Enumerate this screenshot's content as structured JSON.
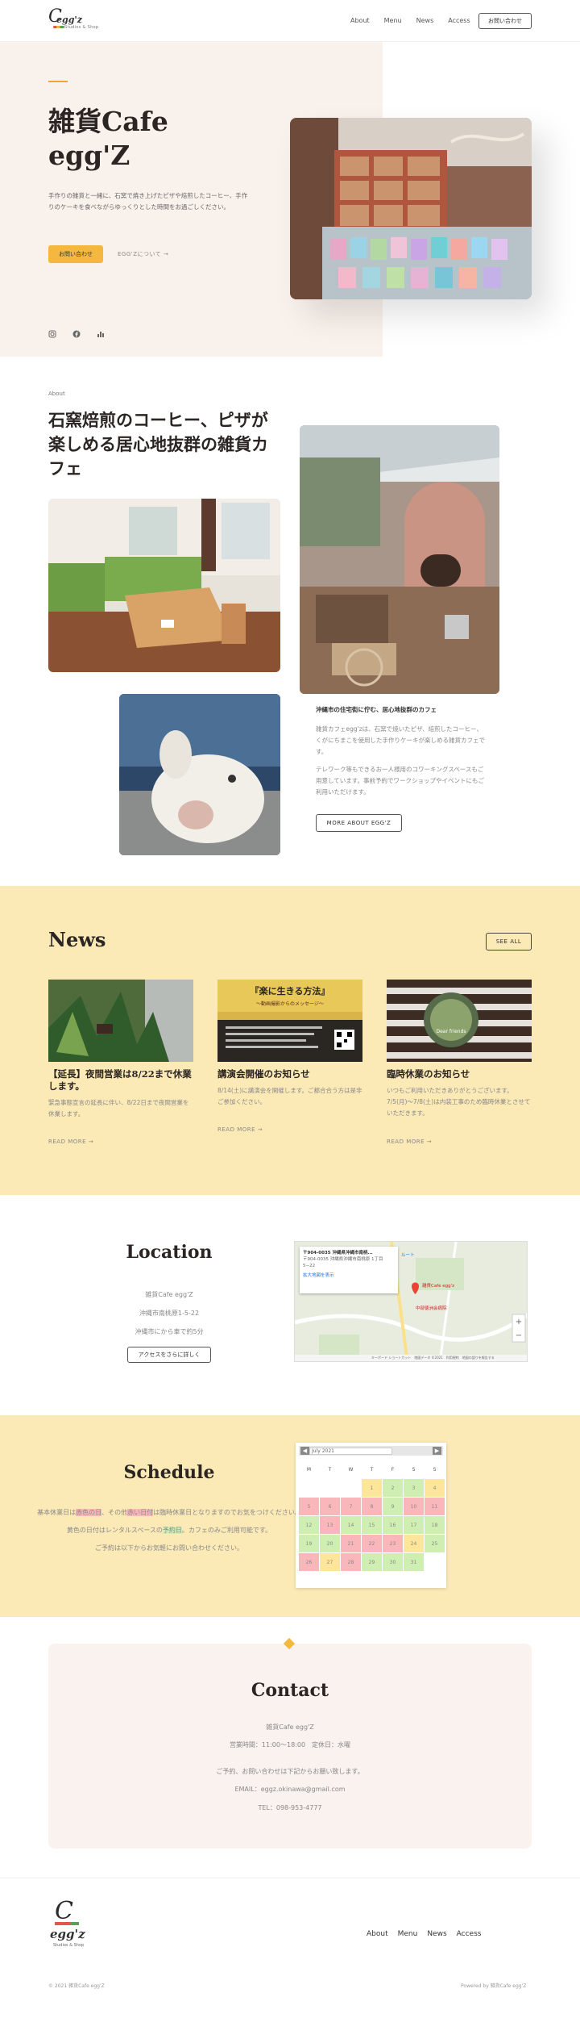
{
  "header": {
    "logo_text": "egg'z",
    "logo_sub": "Studios & Shop",
    "nav": [
      "About",
      "Menu",
      "News",
      "Access"
    ],
    "contact_button": "お問い合わせ"
  },
  "hero": {
    "title_line1": "雑貨Cafe",
    "title_line2": "egg'Z",
    "description": "手作りの雑貨と一緒に、石窯で焼き上げたピザや焙煎したコーヒー、手作りのケーキを食べながらゆっくりとした時間をお過ごしください。",
    "primary_button": "お問い合わせ",
    "secondary_link": "EGG'Zについて →",
    "social_icons": [
      "instagram-icon",
      "facebook-icon",
      "stats-icon"
    ]
  },
  "about": {
    "label": "About",
    "title": "石窯焙煎のコーヒー、ピザが楽しめる居心地抜群の雑貨カフェ",
    "subtitle": "沖縄市の住宅街に佇む、居心地抜群のカフェ",
    "paragraph1": "雑貨カフェegg'zは、石窯で焼いたピザ、焙煎したコーヒー、くがにちまこを使用した手作りケーキが楽しめる雑貨カフェです。",
    "paragraph2": "テレワーク等もできるお一人様用のコワーキングスペースもご用意しています。事前予約でワークショップやイベントにもご利用いただけます。",
    "button": "MORE ABOUT EGG'Z"
  },
  "news": {
    "title": "News",
    "see_all": "SEE ALL",
    "items": [
      {
        "title": "【延長】夜間営業は8/22まで休業します。",
        "text": "緊急事態宣言の延長に伴い、8/22日まで夜間営業を休業します。",
        "read_more": "READ MORE →"
      },
      {
        "title": "講演会開催のお知らせ",
        "text": "8/14(土)に講演会を開催します。ご都合合う方は是非ご参加ください。",
        "read_more": "READ MORE →",
        "poster_title": "『楽に生きる方法』",
        "poster_sub": "〜動画撮影からのメッセージ〜"
      },
      {
        "title": "臨時休業のお知らせ",
        "text": "いつもご利用いただきありがとうございます。7/5(月)〜7/8(土)は内装工事のため臨時休業とさせていただきます。",
        "read_more": "READ MORE →",
        "sign_text": "Dear friends"
      }
    ]
  },
  "location": {
    "title": "Location",
    "lines": [
      "雑貨Cafe egg'Z",
      "沖縄市南桃原1-5-22",
      "沖縄市にから車で約5分"
    ],
    "button": "アクセスをさらに詳しく",
    "map_address_title": "〒904-0035 沖縄県沖縄市南桃...",
    "map_address_detail": "〒904-0035 沖縄県沖縄市南桃原 1丁目5−22",
    "map_link": "拡大地図を表示",
    "map_route": "ルート",
    "map_label1": "雑貨Cafe egg'z",
    "map_label2": "中部徳洲会病院",
    "map_footer": "キーボード ショートカット　地図データ ©2021　利用規約　地図の誤りを報告する"
  },
  "schedule": {
    "title": "Schedule",
    "line1_a": "基本休業日は",
    "line1_red": "赤色の日",
    "line1_b": "、その他",
    "line1_red2": "赤い日付",
    "line1_c": "は臨時休業日となりますのでお気をつけください。",
    "line2_a": "黄色の日付はレンタルスペースの",
    "line2_highlight": "予約日",
    "line2_b": "。カフェのみご利用可能です。",
    "line3": "ご予約は以下からお気軽にお問い合わせください。",
    "calendar_month": "July 2021",
    "weekdays": [
      "M",
      "T",
      "W",
      "T",
      "F",
      "S",
      "S"
    ],
    "days": [
      {
        "d": "",
        "c": "#fff"
      },
      {
        "d": "",
        "c": "#fff"
      },
      {
        "d": "",
        "c": "#fff"
      },
      {
        "d": "1",
        "c": "#fde59a"
      },
      {
        "d": "2",
        "c": "#cfeeb2"
      },
      {
        "d": "3",
        "c": "#cfeeb2"
      },
      {
        "d": "4",
        "c": "#fde59a"
      },
      {
        "d": "5",
        "c": "#f9b7bb"
      },
      {
        "d": "6",
        "c": "#f9b7bb"
      },
      {
        "d": "7",
        "c": "#f9b7bb"
      },
      {
        "d": "8",
        "c": "#f9b7bb"
      },
      {
        "d": "9",
        "c": "#cfeeb2"
      },
      {
        "d": "10",
        "c": "#f9b7bb"
      },
      {
        "d": "11",
        "c": "#f9b7bb"
      },
      {
        "d": "12",
        "c": "#cfeeb2"
      },
      {
        "d": "13",
        "c": "#f9b7bb"
      },
      {
        "d": "14",
        "c": "#cfeeb2"
      },
      {
        "d": "15",
        "c": "#cfeeb2"
      },
      {
        "d": "16",
        "c": "#cfeeb2"
      },
      {
        "d": "17",
        "c": "#cfeeb2"
      },
      {
        "d": "18",
        "c": "#cfeeb2"
      },
      {
        "d": "19",
        "c": "#cfeeb2"
      },
      {
        "d": "20",
        "c": "#cfeeb2"
      },
      {
        "d": "21",
        "c": "#f9b7bb"
      },
      {
        "d": "22",
        "c": "#f9b7bb"
      },
      {
        "d": "23",
        "c": "#f9b7bb"
      },
      {
        "d": "24",
        "c": "#fde59a"
      },
      {
        "d": "25",
        "c": "#cfeeb2"
      },
      {
        "d": "26",
        "c": "#f9b7bb"
      },
      {
        "d": "27",
        "c": "#fde59a"
      },
      {
        "d": "28",
        "c": "#f9b7bb"
      },
      {
        "d": "29",
        "c": "#cfeeb2"
      },
      {
        "d": "30",
        "c": "#cfeeb2"
      },
      {
        "d": "31",
        "c": "#cfeeb2"
      },
      {
        "d": "",
        "c": "#fff"
      }
    ]
  },
  "contact": {
    "title": "Contact",
    "name": "雑貨Cafe egg'Z",
    "hours": "営業時間：11:00〜18:00　定休日：水曜",
    "note": "ご予約、お問い合わせは下記からお願い致します。",
    "email": "EMAIL：eggz.okinawa@gmail.com",
    "tel": "TEL：098-953-4777"
  },
  "footer": {
    "nav": [
      "About",
      "Menu",
      "News",
      "Access"
    ],
    "copyright": "© 2021 雑貨Cafe egg'Z",
    "powered": "Powered by 雑貨Cafe egg'Z"
  },
  "colors": {
    "accent": "#f5b83e",
    "news_bg": "#fbe9b6",
    "hero_bg": "#f9f1ec"
  }
}
